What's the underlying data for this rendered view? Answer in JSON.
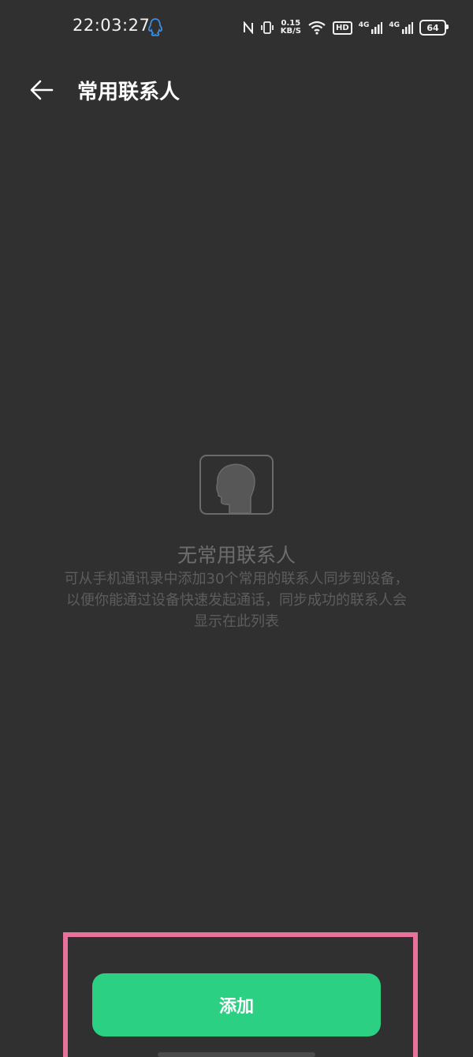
{
  "status_bar": {
    "time": "22:03:27",
    "net_speed_value": "0.15",
    "net_speed_unit": "KB/S",
    "hd_label": "HD",
    "sim1_label": "4G",
    "sim2_label": "4G",
    "battery_level": "64"
  },
  "header": {
    "title": "常用联系人"
  },
  "empty_state": {
    "title": "无常用联系人",
    "description": "可从手机通讯录中添加30个常用的联系人同步到设备，以便你能通过设备快速发起通话，同步成功的联系人会显示在此列表"
  },
  "actions": {
    "add_label": "添加"
  },
  "colors": {
    "background": "#303030",
    "accent": "#2bd083",
    "highlight": "#e8729b",
    "qq_icon": "#3b8fe0"
  }
}
